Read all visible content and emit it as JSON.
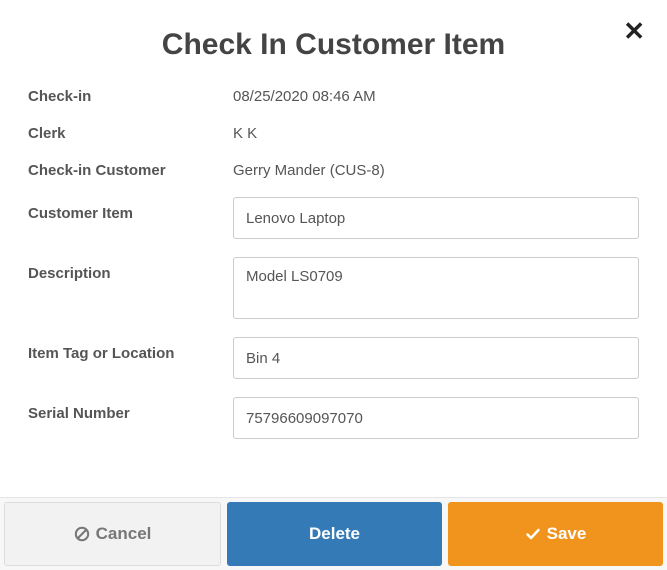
{
  "modal": {
    "title": "Check In Customer Item"
  },
  "fields": {
    "checkin": {
      "label": "Check-in",
      "value": "08/25/2020 08:46 AM"
    },
    "clerk": {
      "label": "Clerk",
      "value": "K K"
    },
    "customer": {
      "label": "Check-in Customer",
      "value": "Gerry Mander (CUS-8)"
    },
    "item": {
      "label": "Customer Item",
      "value": "Lenovo Laptop"
    },
    "description": {
      "label": "Description",
      "value": "Model LS0709"
    },
    "tag": {
      "label": "Item Tag or Location",
      "value": "Bin 4"
    },
    "serial": {
      "label": "Serial Number",
      "value": "75796609097070"
    }
  },
  "buttons": {
    "cancel": "Cancel",
    "delete": "Delete",
    "save": "Save"
  }
}
